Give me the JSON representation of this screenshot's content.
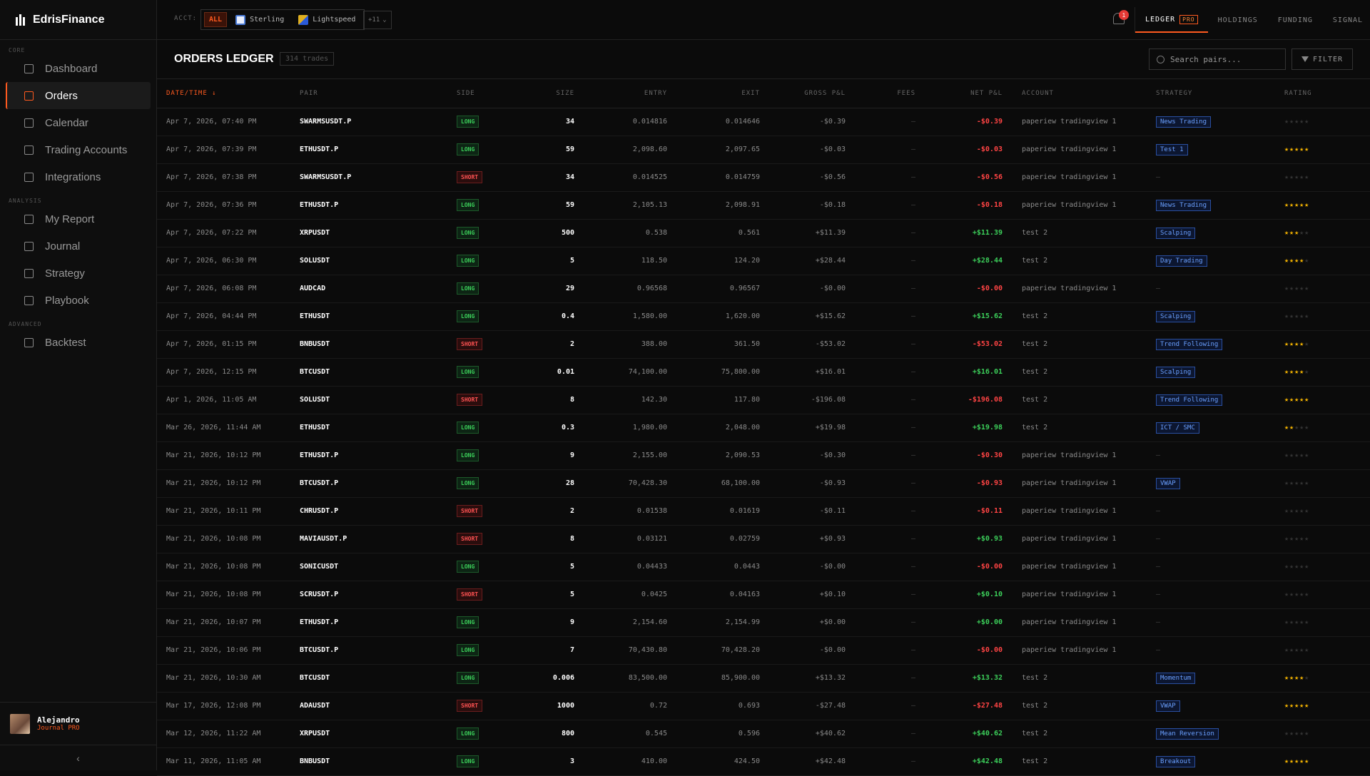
{
  "brand": {
    "name": "EdrisFinance"
  },
  "sidebar": {
    "sections": [
      {
        "label": "CORE",
        "items": [
          {
            "label": "Dashboard",
            "icon": "dashboard-icon",
            "active": false
          },
          {
            "label": "Orders",
            "icon": "orders-icon",
            "active": true
          },
          {
            "label": "Calendar",
            "icon": "calendar-icon",
            "active": false
          },
          {
            "label": "Trading Accounts",
            "icon": "accounts-icon",
            "active": false
          },
          {
            "label": "Integrations",
            "icon": "link-icon",
            "active": false
          }
        ]
      },
      {
        "label": "ANALYSIS",
        "items": [
          {
            "label": "My Report",
            "icon": "chart-icon",
            "active": false
          },
          {
            "label": "Journal",
            "icon": "book-icon",
            "active": false
          },
          {
            "label": "Strategy",
            "icon": "target-icon",
            "active": false
          },
          {
            "label": "Playbook",
            "icon": "bookmark-icon",
            "active": false
          }
        ]
      },
      {
        "label": "ADVANCED",
        "items": [
          {
            "label": "Backtest",
            "icon": "code-icon",
            "active": false
          }
        ]
      }
    ],
    "user": {
      "name": "Alejandro",
      "plan": "Journal PRO"
    },
    "collapse_glyph": "‹"
  },
  "topbar": {
    "acct_label": "ACCT:",
    "all_label": "ALL",
    "accounts": [
      {
        "label": "Sterling",
        "color": "#4a7bd8"
      },
      {
        "label": "Lightspeed",
        "color": "#e0b020"
      }
    ],
    "more_label": "+11",
    "notification_count": "1",
    "tabs": [
      {
        "label": "LEDGER",
        "badge": "PRO",
        "active": true
      },
      {
        "label": "HOLDINGS"
      },
      {
        "label": "FUNDING"
      },
      {
        "label": "SIGNAL"
      }
    ]
  },
  "main": {
    "title": "ORDERS LEDGER",
    "trade_count": "314 trades",
    "search_placeholder": "Search pairs...",
    "filter_label": "FILTER",
    "columns": [
      "DATE/TIME ↓",
      "PAIR",
      "SIDE",
      "SIZE",
      "ENTRY",
      "EXIT",
      "GROSS P&L",
      "FEES",
      "NET P&L",
      "ACCOUNT",
      "STRATEGY",
      "RATING"
    ],
    "rows": [
      {
        "date": "Apr 7, 2026, 07:40 PM",
        "pair": "SWARMSUSDT.P",
        "side": "LONG",
        "size": "34",
        "entry": "0.014816",
        "exit": "0.014646",
        "gross": "-$0.39",
        "fees": "—",
        "net": "-$0.39",
        "account": "paperiew tradingview 1",
        "strategy": "News Trading",
        "rating": 0
      },
      {
        "date": "Apr 7, 2026, 07:39 PM",
        "pair": "ETHUSDT.P",
        "side": "LONG",
        "size": "59",
        "entry": "2,098.60",
        "exit": "2,097.65",
        "gross": "-$0.03",
        "fees": "—",
        "net": "-$0.03",
        "account": "paperiew tradingview 1",
        "strategy": "Test 1",
        "rating": 5
      },
      {
        "date": "Apr 7, 2026, 07:38 PM",
        "pair": "SWARMSUSDT.P",
        "side": "SHORT",
        "size": "34",
        "entry": "0.014525",
        "exit": "0.014759",
        "gross": "-$0.56",
        "fees": "—",
        "net": "-$0.56",
        "account": "paperiew tradingview 1",
        "strategy": "",
        "rating": 0
      },
      {
        "date": "Apr 7, 2026, 07:36 PM",
        "pair": "ETHUSDT.P",
        "side": "LONG",
        "size": "59",
        "entry": "2,105.13",
        "exit": "2,098.91",
        "gross": "-$0.18",
        "fees": "—",
        "net": "-$0.18",
        "account": "paperiew tradingview 1",
        "strategy": "News Trading",
        "rating": 5
      },
      {
        "date": "Apr 7, 2026, 07:22 PM",
        "pair": "XRPUSDT",
        "side": "LONG",
        "size": "500",
        "entry": "0.538",
        "exit": "0.561",
        "gross": "+$11.39",
        "fees": "—",
        "net": "+$11.39",
        "account": "test 2",
        "strategy": "Scalping",
        "rating": 3
      },
      {
        "date": "Apr 7, 2026, 06:30 PM",
        "pair": "SOLUSDT",
        "side": "LONG",
        "size": "5",
        "entry": "118.50",
        "exit": "124.20",
        "gross": "+$28.44",
        "fees": "—",
        "net": "+$28.44",
        "account": "test 2",
        "strategy": "Day Trading",
        "rating": 4
      },
      {
        "date": "Apr 7, 2026, 06:08 PM",
        "pair": "AUDCAD",
        "side": "LONG",
        "size": "29",
        "entry": "0.96568",
        "exit": "0.96567",
        "gross": "-$0.00",
        "fees": "—",
        "net": "-$0.00",
        "account": "paperiew tradingview 1",
        "strategy": "",
        "rating": 0
      },
      {
        "date": "Apr 7, 2026, 04:44 PM",
        "pair": "ETHUSDT",
        "side": "LONG",
        "size": "0.4",
        "entry": "1,580.00",
        "exit": "1,620.00",
        "gross": "+$15.62",
        "fees": "—",
        "net": "+$15.62",
        "account": "test 2",
        "strategy": "Scalping",
        "rating": 0
      },
      {
        "date": "Apr 7, 2026, 01:15 PM",
        "pair": "BNBUSDT",
        "side": "SHORT",
        "size": "2",
        "entry": "388.00",
        "exit": "361.50",
        "gross": "-$53.02",
        "fees": "—",
        "net": "-$53.02",
        "account": "test 2",
        "strategy": "Trend Following",
        "rating": 4
      },
      {
        "date": "Apr 7, 2026, 12:15 PM",
        "pair": "BTCUSDT",
        "side": "LONG",
        "size": "0.01",
        "entry": "74,100.00",
        "exit": "75,800.00",
        "gross": "+$16.01",
        "fees": "—",
        "net": "+$16.01",
        "account": "test 2",
        "strategy": "Scalping",
        "rating": 4
      },
      {
        "date": "Apr 1, 2026, 11:05 AM",
        "pair": "SOLUSDT",
        "side": "SHORT",
        "size": "8",
        "entry": "142.30",
        "exit": "117.80",
        "gross": "-$196.08",
        "fees": "—",
        "net": "-$196.08",
        "account": "test 2",
        "strategy": "Trend Following",
        "rating": 5
      },
      {
        "date": "Mar 26, 2026, 11:44 AM",
        "pair": "ETHUSDT",
        "side": "LONG",
        "size": "0.3",
        "entry": "1,980.00",
        "exit": "2,048.00",
        "gross": "+$19.98",
        "fees": "—",
        "net": "+$19.98",
        "account": "test 2",
        "strategy": "ICT / SMC",
        "rating": 2
      },
      {
        "date": "Mar 21, 2026, 10:12 PM",
        "pair": "ETHUSDT.P",
        "side": "LONG",
        "size": "9",
        "entry": "2,155.00",
        "exit": "2,090.53",
        "gross": "-$0.30",
        "fees": "—",
        "net": "-$0.30",
        "account": "paperiew tradingview 1",
        "strategy": "",
        "rating": 0
      },
      {
        "date": "Mar 21, 2026, 10:12 PM",
        "pair": "BTCUSDT.P",
        "side": "LONG",
        "size": "28",
        "entry": "70,428.30",
        "exit": "68,100.00",
        "gross": "-$0.93",
        "fees": "—",
        "net": "-$0.93",
        "account": "paperiew tradingview 1",
        "strategy": "VWAP",
        "rating": 0
      },
      {
        "date": "Mar 21, 2026, 10:11 PM",
        "pair": "CHRUSDT.P",
        "side": "SHORT",
        "size": "2",
        "entry": "0.01538",
        "exit": "0.01619",
        "gross": "-$0.11",
        "fees": "—",
        "net": "-$0.11",
        "account": "paperiew tradingview 1",
        "strategy": "",
        "rating": 0
      },
      {
        "date": "Mar 21, 2026, 10:08 PM",
        "pair": "MAVIAUSDT.P",
        "side": "SHORT",
        "size": "8",
        "entry": "0.03121",
        "exit": "0.02759",
        "gross": "+$0.93",
        "fees": "—",
        "net": "+$0.93",
        "account": "paperiew tradingview 1",
        "strategy": "",
        "rating": 0
      },
      {
        "date": "Mar 21, 2026, 10:08 PM",
        "pair": "SONICUSDT",
        "side": "LONG",
        "size": "5",
        "entry": "0.04433",
        "exit": "0.0443",
        "gross": "-$0.00",
        "fees": "—",
        "net": "-$0.00",
        "account": "paperiew tradingview 1",
        "strategy": "",
        "rating": 0
      },
      {
        "date": "Mar 21, 2026, 10:08 PM",
        "pair": "SCRUSDT.P",
        "side": "SHORT",
        "size": "5",
        "entry": "0.0425",
        "exit": "0.04163",
        "gross": "+$0.10",
        "fees": "—",
        "net": "+$0.10",
        "account": "paperiew tradingview 1",
        "strategy": "",
        "rating": 0
      },
      {
        "date": "Mar 21, 2026, 10:07 PM",
        "pair": "ETHUSDT.P",
        "side": "LONG",
        "size": "9",
        "entry": "2,154.60",
        "exit": "2,154.99",
        "gross": "+$0.00",
        "fees": "—",
        "net": "+$0.00",
        "account": "paperiew tradingview 1",
        "strategy": "",
        "rating": 0
      },
      {
        "date": "Mar 21, 2026, 10:06 PM",
        "pair": "BTCUSDT.P",
        "side": "LONG",
        "size": "7",
        "entry": "70,430.80",
        "exit": "70,428.20",
        "gross": "-$0.00",
        "fees": "—",
        "net": "-$0.00",
        "account": "paperiew tradingview 1",
        "strategy": "",
        "rating": 0
      },
      {
        "date": "Mar 21, 2026, 10:30 AM",
        "pair": "BTCUSDT",
        "side": "LONG",
        "size": "0.006",
        "entry": "83,500.00",
        "exit": "85,900.00",
        "gross": "+$13.32",
        "fees": "—",
        "net": "+$13.32",
        "account": "test 2",
        "strategy": "Momentum",
        "rating": 4
      },
      {
        "date": "Mar 17, 2026, 12:08 PM",
        "pair": "ADAUSDT",
        "side": "SHORT",
        "size": "1000",
        "entry": "0.72",
        "exit": "0.693",
        "gross": "-$27.48",
        "fees": "—",
        "net": "-$27.48",
        "account": "test 2",
        "strategy": "VWAP",
        "rating": 5
      },
      {
        "date": "Mar 12, 2026, 11:22 AM",
        "pair": "XRPUSDT",
        "side": "LONG",
        "size": "800",
        "entry": "0.545",
        "exit": "0.596",
        "gross": "+$40.62",
        "fees": "—",
        "net": "+$40.62",
        "account": "test 2",
        "strategy": "Mean Reversion",
        "rating": 0
      },
      {
        "date": "Mar 11, 2026, 11:05 AM",
        "pair": "BNBUSDT",
        "side": "LONG",
        "size": "3",
        "entry": "410.00",
        "exit": "424.50",
        "gross": "+$42.48",
        "fees": "—",
        "net": "+$42.48",
        "account": "test 2",
        "strategy": "Breakout",
        "rating": 5
      }
    ]
  }
}
